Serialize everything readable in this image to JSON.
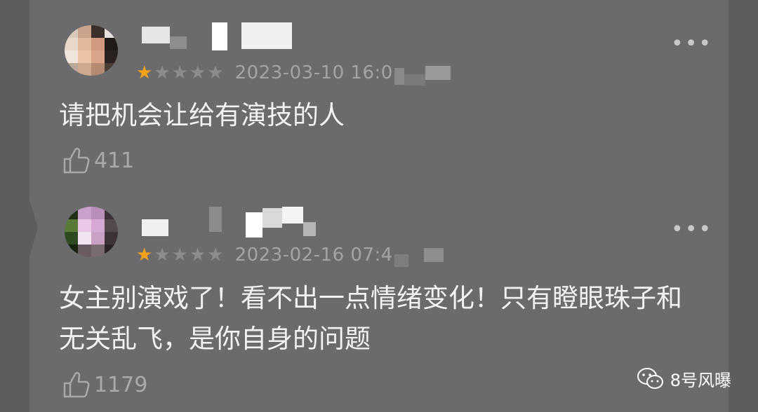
{
  "comments": [
    {
      "rating": 1,
      "max_rating": 5,
      "date": "2023-03-10 16:0",
      "text": "请把机会让给有演技的人",
      "likes": "411",
      "more": "•••"
    },
    {
      "rating": 1,
      "max_rating": 5,
      "date": "2023-02-16 07:4",
      "text": "女主别演戏了！看不出一点情绪变化！只有瞪眼珠子和无关乱飞，是你自身的问题",
      "likes": "1179",
      "more": "•••"
    }
  ],
  "watermark": {
    "text": "8号风曝"
  },
  "icons": {
    "like": "thumbs-up-icon",
    "more": "more-icon",
    "star": "star-icon",
    "wechat": "wechat-icon"
  },
  "colors": {
    "background": "#6b6b6d",
    "star_on": "#f7a21b",
    "star_off": "#8c8c8e",
    "text": "#f2f2f2",
    "meta": "#a4a4a6"
  }
}
